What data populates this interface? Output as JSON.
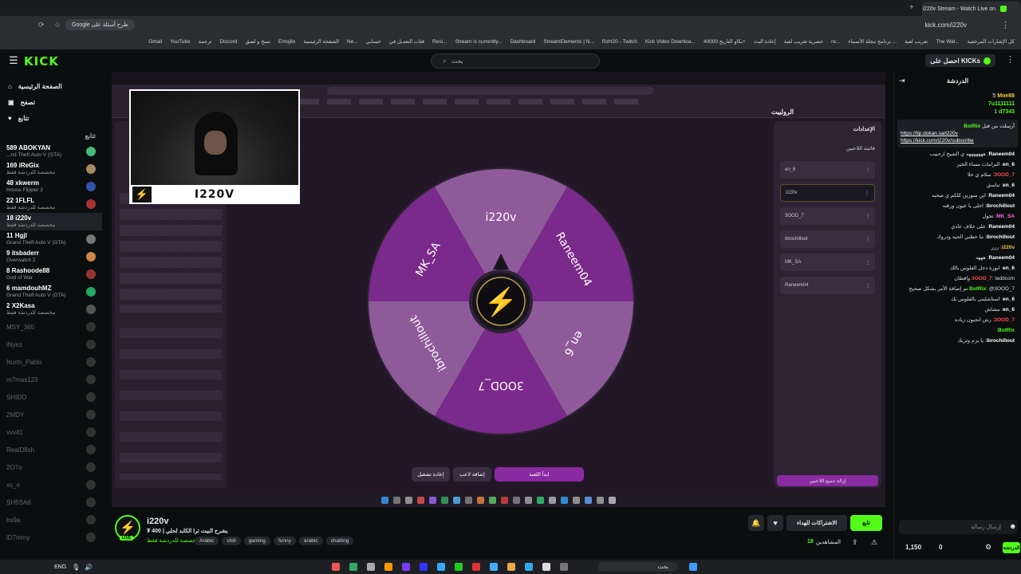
{
  "browser": {
    "tab_title": "i220v Stream - Watch Live on",
    "url": "kick.com/i220v",
    "google_pill": "Google طرح أسئلة على",
    "bookmarks": [
      "كل الإشارات المرجعية",
      "The Wal...",
      "تعريب لعبة",
      "برنامج مجلة الأسماء ...",
      "re...",
      "حضرية تعريب لعبة",
      "إعادة البث",
      "بكاو التاريخ 40000+",
      "Kick Video Downloa...",
      "RzH20 - Twitch",
      "StreamElements | N...",
      "Dashboard",
      "Stream is currently...",
      "Resi...",
      "فئات التعديل في",
      "حسابي",
      "Ne...",
      "الصفحة الرئيسية",
      "Emojilo",
      "نسخ و لصق",
      "Discord",
      "ترجمة",
      "YouTube",
      "Gmail"
    ]
  },
  "kick": {
    "logo": "KICK",
    "search_placeholder": "بحث",
    "get_kicks": "احصل على KICKs"
  },
  "sidebar": {
    "nav": [
      {
        "label": "الصفحة الرئيسية",
        "icon": "home-icon"
      },
      {
        "label": "تصفح",
        "icon": "browse-icon"
      },
      {
        "label": "تتابع",
        "icon": "heart-icon"
      }
    ],
    "section_title": "تتابع",
    "channels": [
      {
        "name": "ABOKYAN",
        "count": "589",
        "game": "...nd Theft Auto V (GTA)",
        "online": true
      },
      {
        "name": "iReGix",
        "count": "169",
        "game": "مخصصة للدردشة فقط",
        "online": true
      },
      {
        "name": "xkwerm",
        "count": "48",
        "game": "House Flipper 2",
        "online": true
      },
      {
        "name": "1FLFL",
        "count": "22",
        "game": "مخصصة للدردشة فقط",
        "online": true
      },
      {
        "name": "i220v",
        "count": "18",
        "game": "مخصصة للدردشة فقط",
        "online": true,
        "active": true
      },
      {
        "name": "Hgjl",
        "count": "11",
        "game": "Grand Theft Auto V (GTA)",
        "online": true
      },
      {
        "name": "itsbaderr",
        "count": "9",
        "game": "Overwatch 2",
        "online": true
      },
      {
        "name": "Rashoode88",
        "count": "8",
        "game": "God of War",
        "online": true
      },
      {
        "name": "mamdouhMZ",
        "count": "6",
        "game": "Grand Theft Auto V (GTA)",
        "online": true
      },
      {
        "name": "X2Kasa",
        "count": "2",
        "game": "مخصصة للدردشة فقط",
        "online": true
      },
      {
        "name": "MSY_365",
        "online": false
      },
      {
        "name": "iNyez",
        "online": false
      },
      {
        "name": "Nurth_Pablo",
        "online": false
      },
      {
        "name": "m7mas123",
        "online": false
      },
      {
        "name": "SHIDO",
        "online": false
      },
      {
        "name": "2MDY",
        "online": false
      },
      {
        "name": "vvv41",
        "online": false
      },
      {
        "name": "RealD8sh",
        "online": false
      },
      {
        "name": "2O7o",
        "online": false
      },
      {
        "name": "xs_o",
        "online": false
      },
      {
        "name": "SH5SA6",
        "online": false
      },
      {
        "name": "bs9a",
        "online": false
      },
      {
        "name": "lD7mmy",
        "online": false
      }
    ]
  },
  "stream": {
    "cam_name": "I220V",
    "wheel_segments": [
      "i220v",
      "Raneem04",
      "en_6",
      "3OOD_7",
      "ibrochillout",
      "MK_SA"
    ],
    "wheel_title": "الرولييت",
    "settings": "الإعدادات",
    "players_list": "قائمة اللاعبين",
    "start_game": "ابدأ اللعبة",
    "add_player": "إضافة لاعب",
    "restart": "إعادة تشغيل",
    "remove_all": "إزالة جميع اللاعبين",
    "players": [
      "en_6",
      "i220v",
      "3OOD_7",
      "ibrochillout",
      "MK_SA",
      "Raneem04"
    ]
  },
  "chat": {
    "title": "الدردشة",
    "top_gifters": [
      {
        "name": "Moe88",
        "value": "5"
      },
      {
        "name": "7u1111111",
        "value": ""
      },
      {
        "name": "d7343",
        "value": "1"
      }
    ],
    "pinned_user": "BotRix",
    "pinned_label": "أرسلت من قبل",
    "pinned_links": [
      "https://tip.dokan.sa/i220v",
      "https://kick.com/i220v/subscribe"
    ],
    "messages": [
      {
        "user": "Raneem04",
        "text": "هههههههه ي الشيخ ارحبيب"
      },
      {
        "user": "en_6",
        "text": "البرامات مساء الخير"
      },
      {
        "user": "3OOD_7",
        "text": "سلام ي حلا"
      },
      {
        "user": "en_6",
        "text": "تناسق"
      },
      {
        "user": "Raneem04",
        "text": "اين منورين كلكم ي صحبه"
      },
      {
        "user": "ibrochillout",
        "text": "احلى يا عيون ورقته"
      },
      {
        "user": "MK_SA",
        "text": "تحول"
      },
      {
        "user": "Raneem04",
        "text": "على خلاف عادي"
      },
      {
        "user": "ibrochillout",
        "text": "ما حطني الحيه ودروك"
      },
      {
        "user": "i220v",
        "text": "ررر"
      },
      {
        "user": "Raneem04",
        "text": "هههه"
      },
      {
        "user": "en_6",
        "text": "ابورة دخل الفلوس بالك"
      },
      {
        "user": "3OOD_7",
        "text": "laddcom واقطان"
      },
      {
        "user": "BotRix",
        "text": "@3OOD_7 تم إضافة الأمر بشكل صحيح"
      },
      {
        "user": "en_6",
        "text": "استاشليني بالفلوس بك"
      },
      {
        "user": "en_6",
        "text": "مشاش"
      },
      {
        "user": "3OOD_7",
        "text": "رش انجبون زياده"
      },
      {
        "user": "BotRix",
        "text": ""
      },
      {
        "user": "ibrochillout",
        "text": "يا يرم وثريك"
      }
    ],
    "input_placeholder": "إرسال رسالة",
    "send_label": "الدردشة",
    "points": "0",
    "kicks": "1,150"
  },
  "info": {
    "streamer": "i220v",
    "title": "يشرح البيت ترا الكايد لحلي | 400 ₮",
    "category": "مخصصة للدردشة فقط",
    "tags": [
      "Arabic",
      "chill",
      "gaming",
      "funny",
      "arabic",
      "chatting"
    ],
    "follow_label": "تابع",
    "subscribe_label": "الاشتراكات للهداء",
    "viewers_label": "المشاهدين",
    "viewers": "18"
  },
  "taskbar": {
    "lang": "ENG",
    "search": "بحث"
  },
  "colors": {
    "kick_green": "#53fc18",
    "wheel_dark": "#7a2a8a",
    "wheel_light": "#8f5a9a"
  }
}
